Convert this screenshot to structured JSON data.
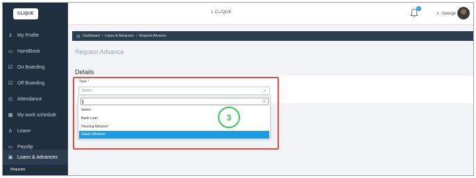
{
  "header": {
    "logo_text": "CLIQUE",
    "app_title": "1 CLIQUE",
    "notification_count": "0",
    "user_name": "George"
  },
  "sidebar": {
    "items": [
      {
        "label": "My Profile",
        "icon": "user-icon"
      },
      {
        "label": "HandBook",
        "icon": "document-icon"
      },
      {
        "label": "On Boarding",
        "icon": "checkbox-icon"
      },
      {
        "label": "Off Boarding",
        "icon": "checkbox-icon"
      },
      {
        "label": "Attendance",
        "icon": "clock-icon"
      },
      {
        "label": "My work schedule",
        "icon": "calendar-icon"
      },
      {
        "label": "Leave",
        "icon": "person-icon"
      },
      {
        "label": "Payslip",
        "icon": "folder-icon"
      },
      {
        "label": "Loans & Advances",
        "icon": "card-icon"
      }
    ],
    "sub_items": [
      {
        "label": "Requests"
      }
    ]
  },
  "breadcrumb": {
    "home": "Dashboard",
    "level1": "Loans & Advances",
    "level2": "Request Advance"
  },
  "page": {
    "title": "Request Advance",
    "section_title": "Details"
  },
  "form": {
    "type_label": "Type *",
    "type_value": "Select",
    "dropdown_options": [
      "Select",
      "Bank Loan",
      "Housing Advance",
      "Salary Advance"
    ],
    "highlighted_option": "Salary Advance"
  },
  "annotation": {
    "step_number": "3",
    "highlight_color": "#e24b42",
    "step_color": "#35c759"
  },
  "colors": {
    "sidebar_bg": "#1f2f3f",
    "accent": "#1e9be0"
  }
}
